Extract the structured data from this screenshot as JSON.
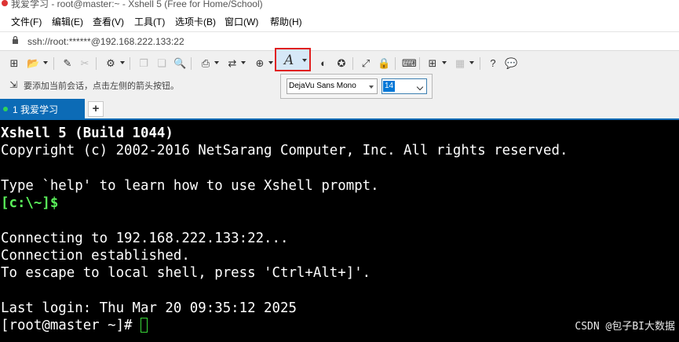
{
  "window": {
    "title": "我爱学习 - root@master:~ - Xshell 5 (Free for Home/School)"
  },
  "menu": [
    "文件(F)",
    "编辑(E)",
    "查看(V)",
    "工具(T)",
    "选项卡(B)",
    "窗口(W)",
    "帮助(H)"
  ],
  "address": "ssh://root:******@192.168.222.133:22",
  "hint": "要添加当前会话，点击左侧的箭头按钮。",
  "font_popup": {
    "font_name": "DejaVu Sans Mono",
    "font_size": "14"
  },
  "tabs": [
    {
      "label": "1 我爱学习"
    }
  ],
  "add_tab_symbol": "+",
  "terminal": {
    "lines": [
      "Xshell 5 (Build 1044)",
      "Copyright (c) 2002-2016 NetSarang Computer, Inc. All rights reserved.",
      "",
      "Type `help' to learn how to use Xshell prompt.",
      "[c:\\~]$",
      "",
      "Connecting to 192.168.222.133:22...",
      "Connection established.",
      "To escape to local shell, press 'Ctrl+Alt+]'.",
      "",
      "Last login: Thu Mar 20 09:35:12 2025"
    ],
    "prompt": "[root@master ~]# "
  },
  "watermark": "CSDN @包子BI大数据",
  "colors": {
    "tab_active": "#0c6bb6",
    "terminal_bg": "#000000",
    "prompt_green": "#5af05a",
    "highlight_box": "#e02020"
  },
  "toolbar_icons": [
    "new-session-icon",
    "open-folder-icon",
    "reconnect-icon",
    "disconnect-icon",
    "properties-icon",
    "copy-icon",
    "paste-icon",
    "find-icon",
    "print-icon",
    "transfer-icon",
    "globe-icon",
    "font-icon",
    "color-scheme-icon",
    "script-icon",
    "fullscreen-icon",
    "lock-icon",
    "keyboard-icon",
    "new-tab-icon",
    "layout-icon",
    "help-icon",
    "chat-icon"
  ]
}
